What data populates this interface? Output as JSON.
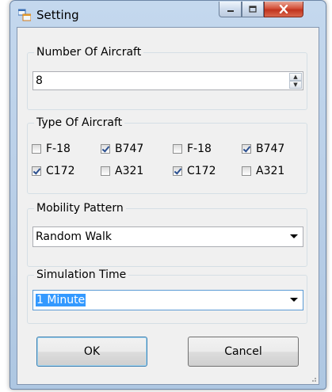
{
  "window": {
    "title": "Setting",
    "icon": "app-form-icon",
    "controls": [
      "minimize-icon",
      "maximize-icon",
      "close-icon"
    ]
  },
  "number_of_aircraft": {
    "label": "Number Of Aircraft",
    "value": "8"
  },
  "type_of_aircraft": {
    "label": "Type Of Aircraft",
    "options": [
      {
        "label": "F-18",
        "checked": false
      },
      {
        "label": "B747",
        "checked": true
      },
      {
        "label": "F-18",
        "checked": false
      },
      {
        "label": "B747",
        "checked": true
      },
      {
        "label": "C172",
        "checked": true
      },
      {
        "label": "A321",
        "checked": false
      },
      {
        "label": "C172",
        "checked": true
      },
      {
        "label": "A321",
        "checked": false
      }
    ]
  },
  "mobility_pattern": {
    "label": "Mobility Pattern",
    "value": "Random Walk"
  },
  "simulation_time": {
    "label": "Simulation Time",
    "value": "1 Minute"
  },
  "buttons": {
    "ok": "OK",
    "cancel": "Cancel"
  },
  "colors": {
    "selection": "#3399ff",
    "close_button": "#c7452b",
    "title_bar": "#b9cfe8"
  }
}
